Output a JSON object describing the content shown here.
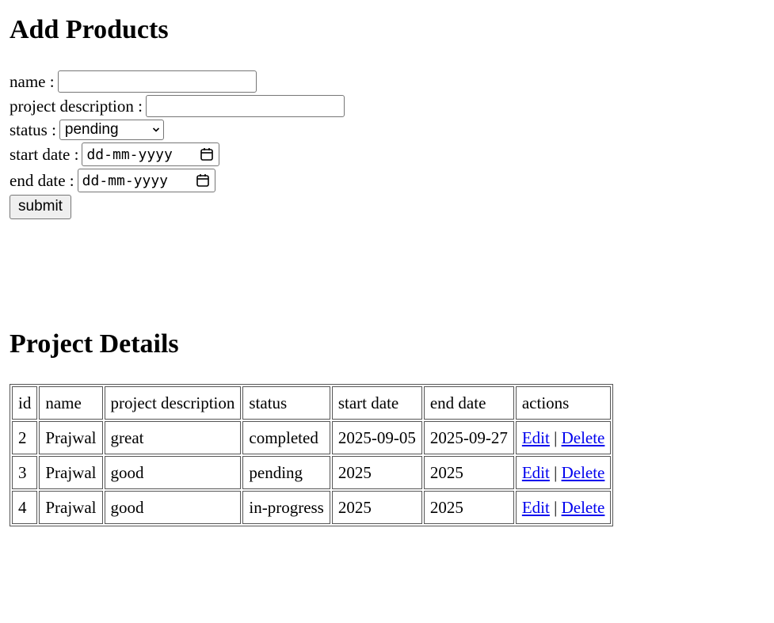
{
  "add_title": "Add Products",
  "form": {
    "name_label": "name :",
    "name_value": "",
    "desc_label": "project description :",
    "desc_value": "",
    "status_label": "status :",
    "status_value": "pending",
    "start_label": "start date :",
    "start_placeholder": "dd-mm-yyyy",
    "end_label": "end date :",
    "end_placeholder": "dd-mm-yyyy",
    "submit_label": "submit"
  },
  "details_title": "Project Details",
  "table": {
    "headers": [
      "id",
      "name",
      "project description",
      "status",
      "start date",
      "end date",
      "actions"
    ],
    "rows": [
      {
        "id": "2",
        "name": "Prajwal",
        "desc": "great",
        "status": "completed",
        "start": "2025-09-05",
        "end": "2025-09-27"
      },
      {
        "id": "3",
        "name": "Prajwal",
        "desc": "good",
        "status": "pending",
        "start": "2025",
        "end": "2025"
      },
      {
        "id": "4",
        "name": "Prajwal",
        "desc": "good",
        "status": "in-progress",
        "start": "2025",
        "end": "2025"
      }
    ],
    "edit_label": "Edit",
    "separator": "|",
    "delete_label": "Delete"
  },
  "icons": {
    "select_arrow": "chevron-down-icon",
    "date_picker": "calendar-icon"
  }
}
